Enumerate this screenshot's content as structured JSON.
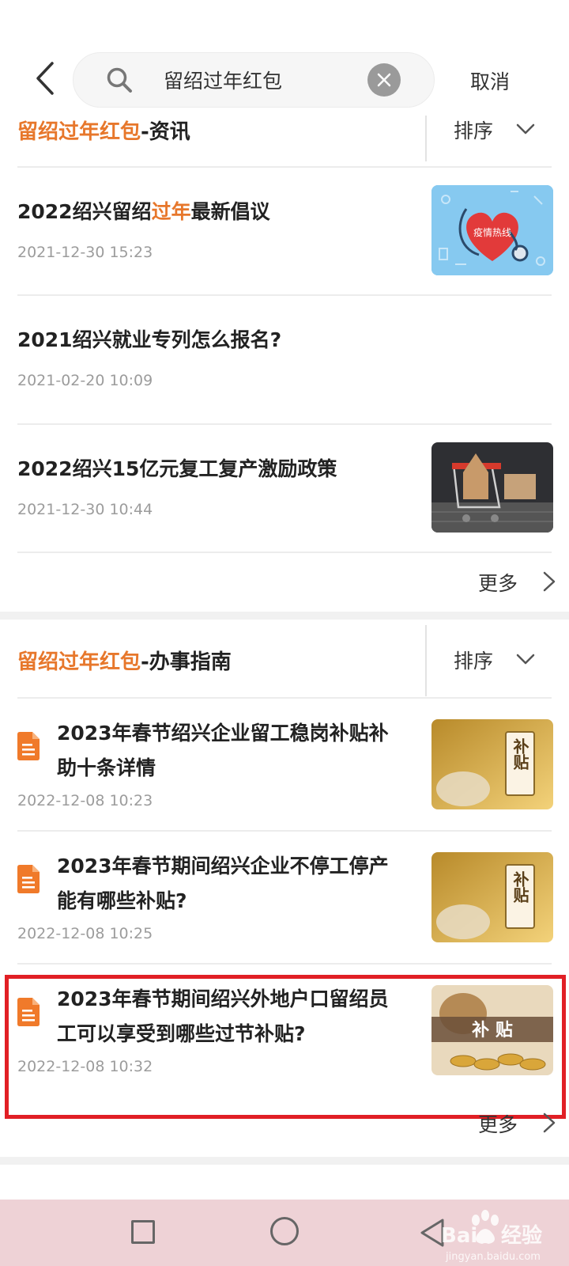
{
  "search": {
    "query": "留绍过年红包",
    "cancel_label": "取消"
  },
  "news_section": {
    "title_keyword": "留绍过年红包",
    "title_suffix": "-资讯",
    "sort_label": "排序",
    "more_label": "更多",
    "items": [
      {
        "title_pre": "2022绍兴留绍",
        "title_kw": "过年",
        "title_post": "最新倡议",
        "time": "2021-12-30 15:23",
        "thumb_text": "疫情热线"
      },
      {
        "title_pre": "2021绍兴就业专列怎么报名?",
        "title_kw": "",
        "title_post": "",
        "time": "2021-02-20 10:09"
      },
      {
        "title_pre": "2022绍兴15亿元复工复产激励政策",
        "title_kw": "",
        "title_post": "",
        "time": "2021-12-30 10:44"
      }
    ]
  },
  "guide_section": {
    "title_keyword": "留绍过年红包",
    "title_suffix": "-办事指南",
    "sort_label": "排序",
    "more_label": "更多",
    "items": [
      {
        "title_line1": "2023年春节绍兴企业留工稳岗补贴补",
        "title_line2": "助十条详情",
        "time": "2022-12-08 10:23",
        "thumb_text": "补贴"
      },
      {
        "title_line1": "2023年春节期间绍兴企业不停工停产",
        "title_line2": "能有哪些补贴?",
        "time": "2022-12-08 10:25",
        "thumb_text": "补贴"
      },
      {
        "title_line1": "2023年春节期间绍兴外地户口留绍员",
        "title_line2": "工可以享受到哪些过节补贴?",
        "time": "2022-12-08 10:32",
        "thumb_text": "补 贴"
      }
    ]
  },
  "watermark": {
    "brand": "Bai",
    "brand_cn": "经验",
    "url": "jingyan.baidu.com"
  },
  "colors": {
    "accent": "#e7772b",
    "highlight": "#e11f25",
    "navbar": "#eed2d6"
  }
}
